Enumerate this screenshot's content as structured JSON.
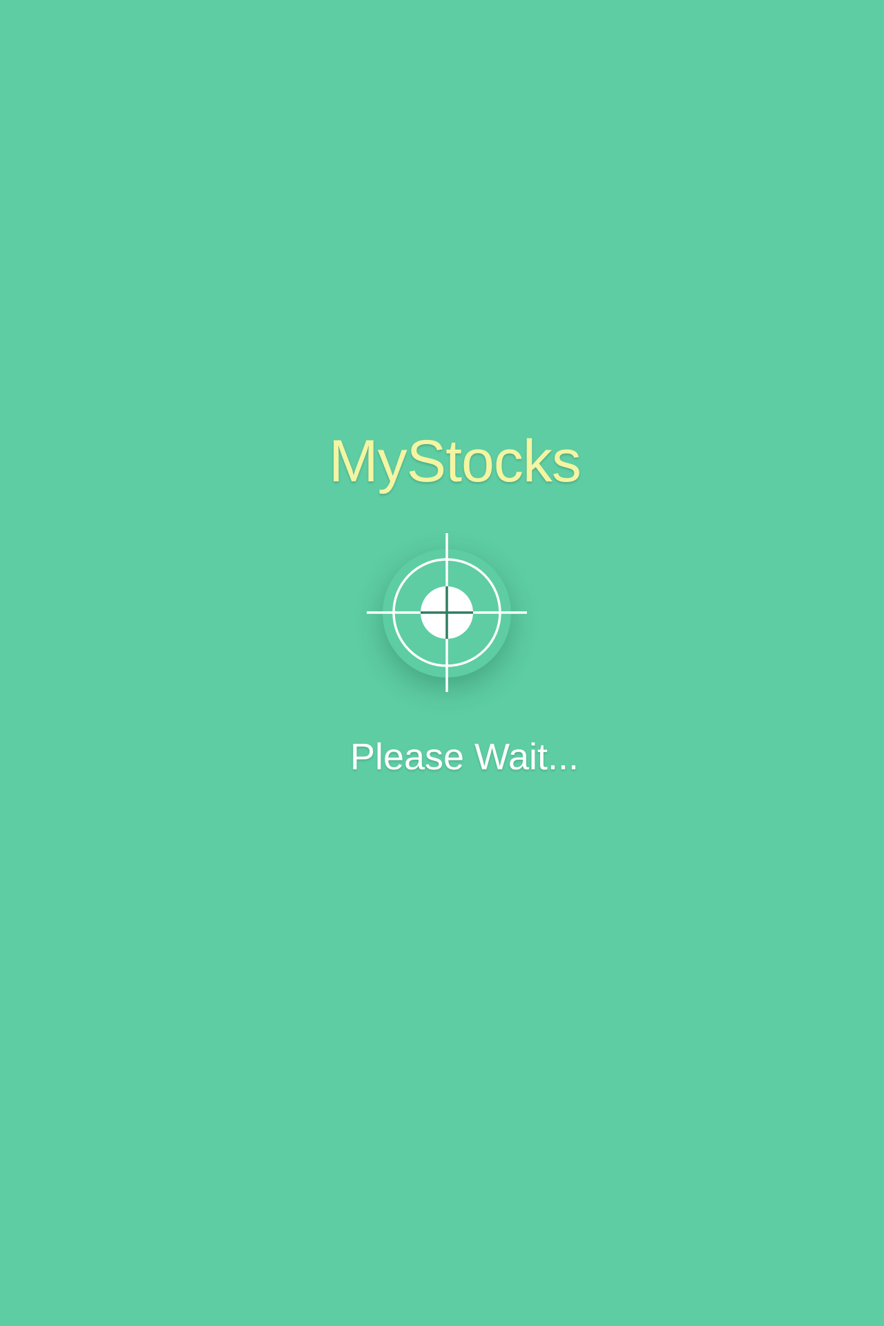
{
  "app": {
    "title": "MyStocks"
  },
  "loader": {
    "icon": "crosshair-target-icon",
    "status_text": "Please Wait..."
  },
  "colors": {
    "background": "#5ecda3",
    "title": "#f3f5a2",
    "icon_and_text": "#ffffff",
    "icon_crosshair_inner": "#2f7e5f"
  }
}
